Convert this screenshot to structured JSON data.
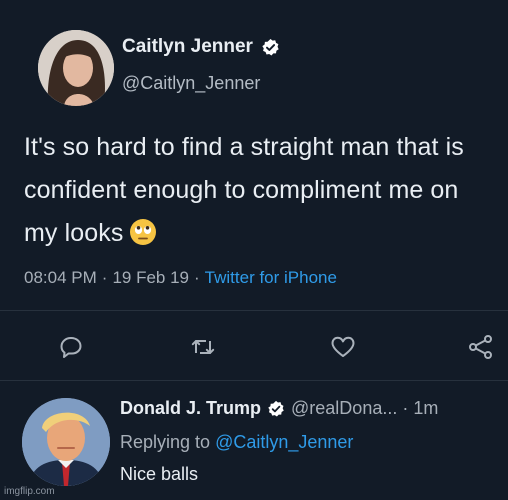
{
  "tweet": {
    "display_name": "Caitlyn Jenner",
    "handle": "@Caitlyn_Jenner",
    "text": "It's so hard to find a straight man that is confident enough to compliment me on my looks",
    "emoji_icon": "face-with-rolling-eyes-icon",
    "time": "08:04 PM",
    "date": "19 Feb 19",
    "sep": "·",
    "source": "Twitter for iPhone",
    "accent_color": "#2f9be8"
  },
  "actions": {
    "reply_icon": "reply-icon",
    "retweet_icon": "retweet-icon",
    "like_icon": "heart-icon",
    "share_icon": "share-icon"
  },
  "reply": {
    "display_name": "Donald J. Trump",
    "handle": "@realDona...",
    "sep": "·",
    "time": "1m",
    "replying_prefix": "Replying to",
    "replying_to": "@Caitlyn_Jenner",
    "text": "Nice balls"
  },
  "watermark": "imgflip.com"
}
